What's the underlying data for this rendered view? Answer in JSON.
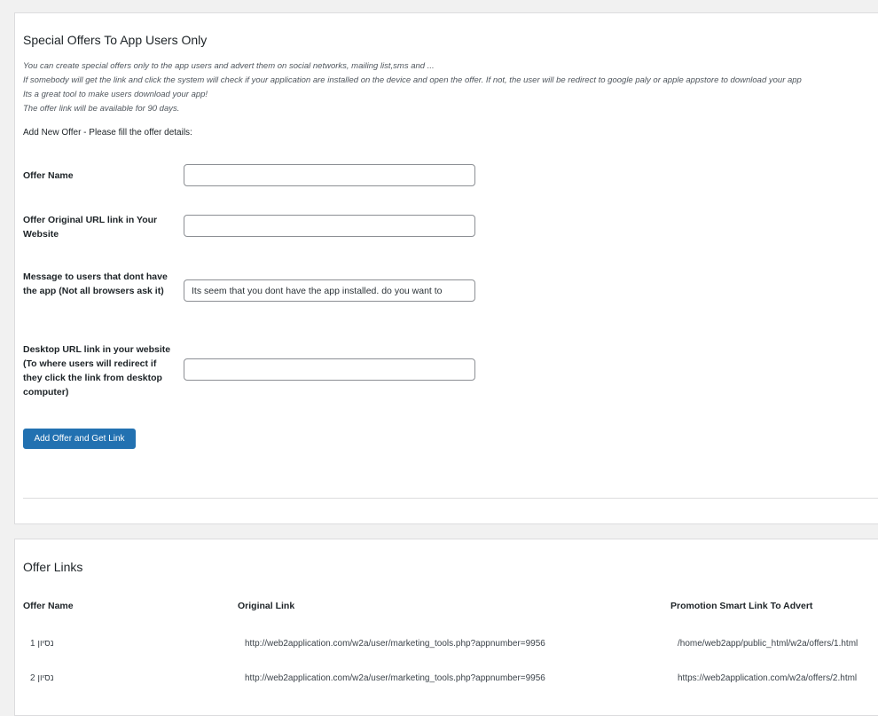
{
  "offer_form": {
    "title": "Special Offers To App Users Only",
    "description": [
      "You can create special offers only to the app users and advert them on social networks, mailing list,sms and ...",
      "If somebody will get the link and click the system will check if your application are installed on the device and open the offer. If not, the user will be redirect to google paly or apple appstore to download your app",
      "Its a great tool to make users download your app!",
      "The offer link will be available for 90 days."
    ],
    "subheading": "Add New Offer - Please fill the offer details:",
    "fields": [
      {
        "label": "Offer Name",
        "value": ""
      },
      {
        "label": "Offer Original URL link in Your Website",
        "value": ""
      },
      {
        "label": "Message to users that dont have the app (Not all browsers ask it)",
        "value": "Its seem that you dont have the app installed. do you want to"
      },
      {
        "label": "Desktop URL link in your website (To where users will redirect if they click the link from desktop computer)",
        "value": ""
      }
    ],
    "submit_label": "Add Offer and Get Link"
  },
  "offer_links": {
    "title": "Offer Links",
    "columns": [
      "Offer Name",
      "Original Link",
      "Promotion Smart Link To Advert"
    ],
    "rows": [
      {
        "name": "נסיון 1",
        "original": "http://web2application.com/w2a/user/marketing_tools.php?appnumber=9956",
        "promo": "/home/web2app/public_html/w2a/offers/1.html"
      },
      {
        "name": "נסיון 2",
        "original": "http://web2application.com/w2a/user/marketing_tools.php?appnumber=9956",
        "promo": "https://web2application.com/w2a/offers/2.html"
      }
    ]
  },
  "colors": {
    "primary": "#2271b1",
    "page_bg": "#f1f1f1",
    "panel_bg": "#ffffff"
  }
}
